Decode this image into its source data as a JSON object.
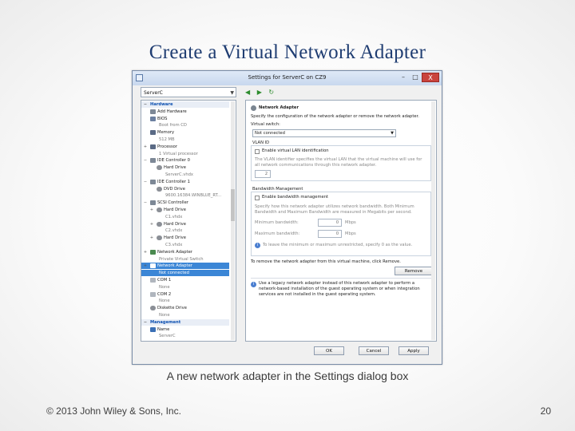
{
  "slide": {
    "title": "Create a Virtual Network Adapter",
    "caption": "A new network adapter in the Settings dialog box",
    "footer": "© 2013 John Wiley & Sons, Inc.",
    "page_number": "20"
  },
  "dialog": {
    "title": "Settings for ServerC on CZ9",
    "window_buttons": {
      "minimize": "–",
      "maximize": "□",
      "close": "X"
    },
    "server_select": "ServerC",
    "toolbar": {
      "back": "◀",
      "forward": "▶",
      "refresh": "↻"
    },
    "tree": [
      {
        "label": "Hardware",
        "kind": "section",
        "toggle": "−"
      },
      {
        "label": "Add Hardware",
        "kind": "item",
        "icon": "hardware-icon"
      },
      {
        "label": "BIOS",
        "kind": "item",
        "icon": "bios-icon"
      },
      {
        "label": "Boot from CD",
        "kind": "sub"
      },
      {
        "label": "Memory",
        "kind": "item",
        "icon": "memory-icon"
      },
      {
        "label": "512 MB",
        "kind": "sub"
      },
      {
        "label": "Processor",
        "kind": "item",
        "icon": "processor-icon",
        "toggle": "+"
      },
      {
        "label": "1 Virtual processor",
        "kind": "sub"
      },
      {
        "label": "IDE Controller 0",
        "kind": "item",
        "icon": "ide-controller-icon",
        "toggle": "−"
      },
      {
        "label": "Hard Drive",
        "kind": "item2",
        "icon": "hard-drive-icon"
      },
      {
        "label": "ServerC.vhdx",
        "kind": "sub2"
      },
      {
        "label": "IDE Controller 1",
        "kind": "item",
        "icon": "ide-controller-icon",
        "toggle": "−"
      },
      {
        "label": "DVD Drive",
        "kind": "item2",
        "icon": "dvd-drive-icon"
      },
      {
        "label": "9600.16384.WINBLUE_RT...",
        "kind": "sub2"
      },
      {
        "label": "SCSI Controller",
        "kind": "item",
        "icon": "scsi-controller-icon",
        "toggle": "−"
      },
      {
        "label": "Hard Drive",
        "kind": "item2",
        "icon": "hard-drive-icon",
        "toggle": "+"
      },
      {
        "label": "C1.vhdx",
        "kind": "sub2"
      },
      {
        "label": "Hard Drive",
        "kind": "item2",
        "icon": "hard-drive-icon",
        "toggle": "+"
      },
      {
        "label": "C2.vhdx",
        "kind": "sub2"
      },
      {
        "label": "Hard Drive",
        "kind": "item2",
        "icon": "hard-drive-icon",
        "toggle": "+"
      },
      {
        "label": "C3.vhdx",
        "kind": "sub2"
      },
      {
        "label": "Network Adapter",
        "kind": "item",
        "icon": "network-adapter-icon",
        "toggle": "+"
      },
      {
        "label": "Private Virtual Switch",
        "kind": "sub"
      },
      {
        "label": "Network Adapter",
        "kind": "selected",
        "icon": "network-adapter-icon",
        "toggle": "+"
      },
      {
        "label": "Not connected",
        "kind": "selected-sub"
      },
      {
        "label": "COM 1",
        "kind": "item",
        "icon": "com-port-icon"
      },
      {
        "label": "None",
        "kind": "sub"
      },
      {
        "label": "COM 2",
        "kind": "item",
        "icon": "com-port-icon"
      },
      {
        "label": "None",
        "kind": "sub"
      },
      {
        "label": "Diskette Drive",
        "kind": "item",
        "icon": "diskette-drive-icon"
      },
      {
        "label": "None",
        "kind": "sub"
      },
      {
        "label": "Management",
        "kind": "section",
        "toggle": "−"
      },
      {
        "label": "Name",
        "kind": "item",
        "icon": "name-icon"
      },
      {
        "label": "ServerC",
        "kind": "sub"
      }
    ],
    "settings": {
      "section_title": "Network Adapter",
      "intro": "Specify the configuration of the network adapter or remove the network adapter.",
      "virtual_switch_label": "Virtual switch:",
      "virtual_switch_value": "Not connected",
      "vlan_group_label": "VLAN ID",
      "vlan_checkbox_label": "Enable virtual LAN identification",
      "vlan_desc": "The VLAN identifier specifies the virtual LAN that the virtual machine will use for all network communications through this network adapter.",
      "vlan_value": "2",
      "bw_group_label": "Bandwidth Management",
      "bw_checkbox_label": "Enable bandwidth management",
      "bw_desc": "Specify how this network adapter utilizes network bandwidth. Both Minimum Bandwidth and Maximum Bandwidth are measured in Megabits per second.",
      "min_bw_label": "Minimum bandwidth:",
      "min_bw_value": "0",
      "max_bw_label": "Maximum bandwidth:",
      "max_bw_value": "0",
      "unit": "Mbps",
      "unrestricted_note": "To leave the minimum or maximum unrestricted, specify 0 as the value.",
      "remove_prompt": "To remove the network adapter from this virtual machine, click Remove.",
      "remove_button": "Remove",
      "legacy_note": "Use a legacy network adapter instead of this network adapter to perform a network-based installation of the guest operating system or when integration services are not installed in the guest operating system."
    },
    "buttons": {
      "ok": "OK",
      "cancel": "Cancel",
      "apply": "Apply"
    }
  }
}
